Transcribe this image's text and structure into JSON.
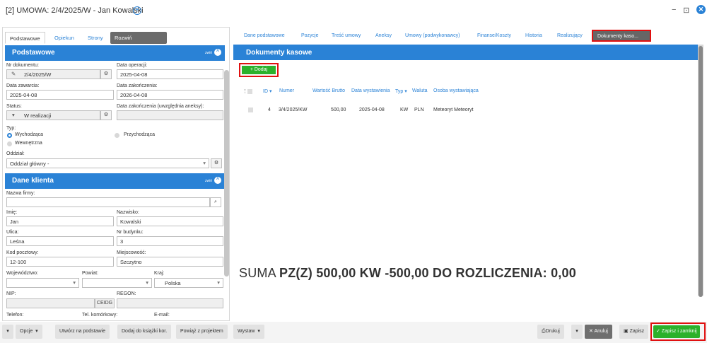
{
  "window": {
    "title": "[2] UMOWA: 2/4/2025/W - Jan Kowalski",
    "plus": "+",
    "minimize": "−",
    "restore": "⊡",
    "close": "✕"
  },
  "left_tabs": [
    "Podstawowe",
    "Opiekun",
    "Strony",
    "Rozwiń"
  ],
  "left_tab_hint": "",
  "sections": {
    "basic": {
      "title": "Podstawowe",
      "collapse": "zwiń"
    },
    "client": {
      "title": "Dane klienta",
      "collapse": "zwiń"
    }
  },
  "form": {
    "nr_label": "Nr dokumentu:",
    "nr_value": "2/4/2025/W",
    "op_label": "Data operacji:",
    "op_value": "2025-04-08",
    "zaw_label": "Data zawarcia:",
    "zaw_value": "2025-04-08",
    "zak_label": "Data zakończenia:",
    "zak_value": "2026-04-08",
    "status_label": "Status:",
    "status_value": "W realizacji",
    "zak2_label": "Data zakończenia (uwzględnia aneksy):",
    "zak2_value": "",
    "typ_label": "Typ:",
    "typ_options": [
      "Wychodząca",
      "Przychodząca",
      "Wewnętrzna"
    ],
    "oddzial_label": "Oddział:",
    "oddzial_value": "Oddział główny -"
  },
  "client": {
    "firma_label": "Nazwa firmy:",
    "firma_value": "",
    "imie_label": "Imię:",
    "imie_value": "Jan",
    "nazwisko_label": "Nazwisko:",
    "nazwisko_value": "Kowalski",
    "ulica_label": "Ulica:",
    "ulica_value": "Leśna",
    "nr_label": "Nr budynku:",
    "nr_value": "3",
    "kod_label": "Kod pocztowy:",
    "kod_value": "12-100",
    "miasto_label": "Miejscowość:",
    "miasto_value": "Szczytno",
    "woj_label": "Województwo:",
    "powiat_label": "Powiat:",
    "kraj_label": "Kraj:",
    "kraj_value": "Polska",
    "nip_label": "NIP:",
    "ceidg": "CEIDG",
    "regon_label": "REGON:",
    "tel_label": "Telefon:",
    "kom_label": "Tel. komórkowy:",
    "email_label": "E-mail:"
  },
  "right_tabs": [
    "Dane podstawowe",
    "Pozycje",
    "Treść umowy",
    "Aneksy",
    "Umowy (podwykonawcy)",
    "Finanse/Koszty",
    "Historia",
    "Realizujący",
    "Dokumenty kaso..."
  ],
  "right_section": "Dokumenty kasowe",
  "add_label": "+ Dodaj",
  "table": {
    "headers": [
      "ID",
      "Numer",
      "Wartość Brutto",
      "Data wystawienia",
      "Typ",
      "Waluta",
      "Osoba wystawiająca"
    ],
    "rows": [
      [
        "4",
        "3/4/2025/KW",
        "500,00",
        "2025-04-08",
        "KW",
        "PLN",
        "Meteoryt Meteoryt"
      ]
    ]
  },
  "summary": {
    "prefix": "SUMA ",
    "bold": "PZ(Z) 500,00 KW -500,00 DO ROZLICZENIA: 0,00"
  },
  "bottom": {
    "opcje": "Opcje",
    "utworz": "Utwórz na podstawie",
    "dodaj_ks": "Dodaj do książki kor.",
    "powiaz": "Powiąż z projektem",
    "wystaw": "Wystaw",
    "drukuj": "Drukuj",
    "anuluj": "Anuluj",
    "zapisz": "Zapisz",
    "zapisz_zamknij": "✓ Zapisz i zamknij"
  },
  "colors": {
    "accent": "#2a82d6",
    "success": "#2bb12b",
    "highlight": "#e01010"
  }
}
